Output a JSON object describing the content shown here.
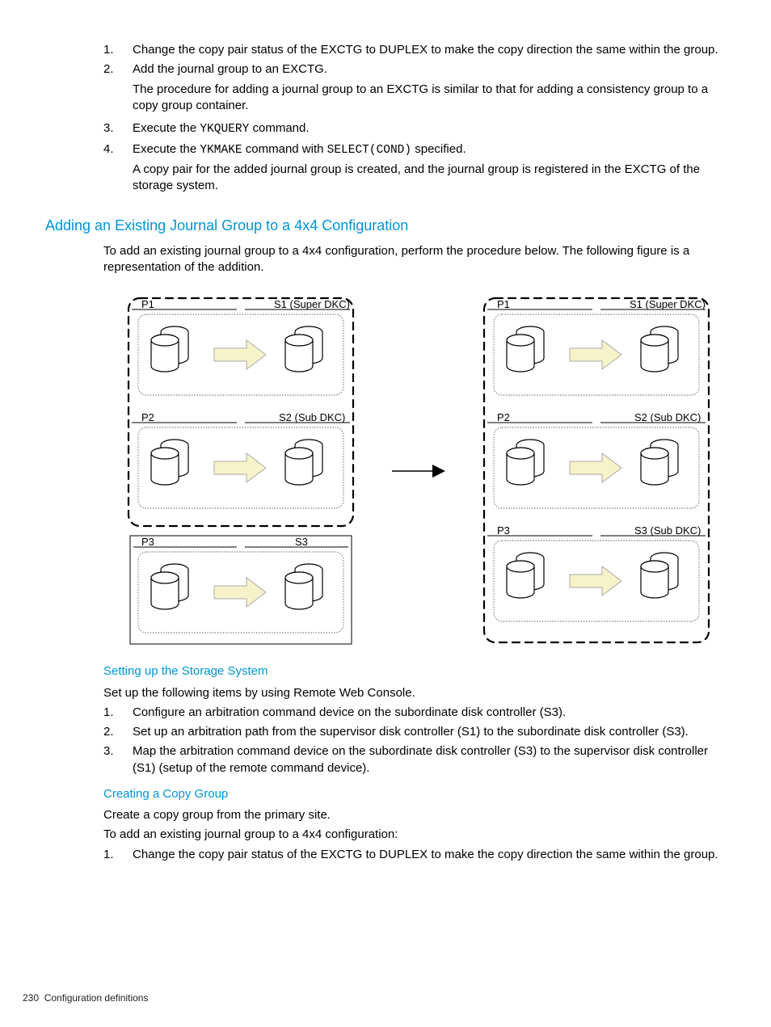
{
  "intro_steps": [
    {
      "num": "1.",
      "text": "Change the copy pair status of the EXCTG to DUPLEX to make the copy direction the same within the group."
    },
    {
      "num": "2.",
      "text": "Add the journal group to an EXCTG.",
      "detail": "The procedure for adding a journal group to an EXCTG is similar to that for adding a consistency group to a copy group container."
    },
    {
      "num": "3.",
      "pre": "Execute the ",
      "code": "YKQUERY",
      "post": " command."
    },
    {
      "num": "4.",
      "pre": "Execute the ",
      "code": "YKMAKE",
      "mid": " command with ",
      "code2": "SELECT(COND)",
      "post": " specified.",
      "detail": "A copy pair for the added journal group is created, and the journal group is registered in the EXCTG of the storage system."
    }
  ],
  "heading_main": "Adding an Existing Journal Group to a 4x4 Configuration",
  "main_intro": "To add an existing journal group to a 4x4 configuration, perform the procedure below. The following figure is a representation of the addition.",
  "diagram": {
    "left": {
      "rows": [
        {
          "l": "P1",
          "r": "S1 (Super DKC)"
        },
        {
          "l": "P2",
          "r": "S2 (Sub DKC)"
        },
        {
          "l": "P3",
          "r": "S3"
        }
      ]
    },
    "right": {
      "rows": [
        {
          "l": "P1",
          "r": "S1 (Super DKC)"
        },
        {
          "l": "P2",
          "r": "S2 (Sub DKC)"
        },
        {
          "l": "P3",
          "r": "S3 (Sub DKC)"
        }
      ]
    }
  },
  "setup_heading": "Setting up the Storage System",
  "setup_intro": "Set up the following items by using Remote Web Console.",
  "setup_steps": [
    {
      "num": "1.",
      "text": "Configure an arbitration command device on the subordinate disk controller (S3)."
    },
    {
      "num": "2.",
      "text": "Set up an arbitration path from the supervisor disk controller (S1) to the subordinate disk controller (S3)."
    },
    {
      "num": "3.",
      "text": "Map the arbitration command device on the subordinate disk controller (S3) to the supervisor disk controller (S1) (setup of the remote command device)."
    }
  ],
  "cg_heading": "Creating a Copy Group",
  "cg_intro1": "Create a copy group from the primary site.",
  "cg_intro2": "To add an existing journal group to a 4x4 configuration:",
  "cg_steps": [
    {
      "num": "1.",
      "text": "Change the copy pair status of the EXCTG to DUPLEX to make the copy direction the same within the group."
    }
  ],
  "footer_page": "230",
  "footer_text": "Configuration definitions"
}
